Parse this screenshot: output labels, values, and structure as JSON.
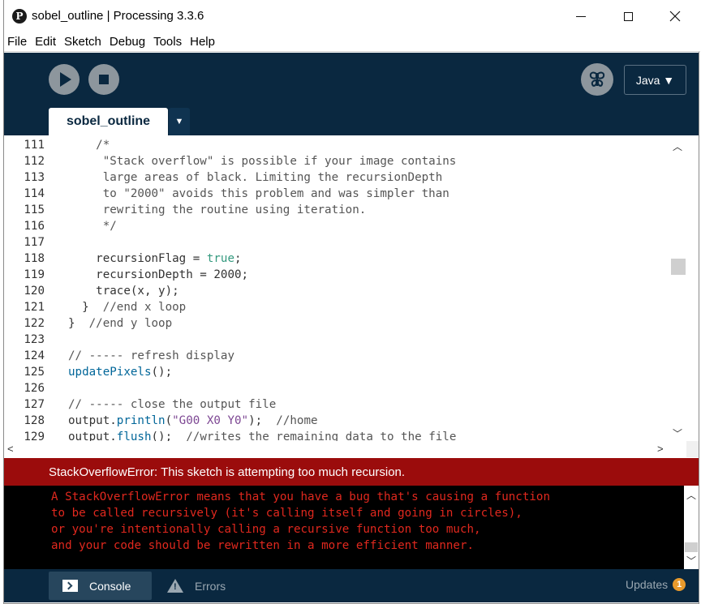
{
  "window": {
    "title": "sobel_outline | Processing 3.3.6",
    "logo": "P"
  },
  "menu": [
    "File",
    "Edit",
    "Sketch",
    "Debug",
    "Tools",
    "Help"
  ],
  "toolbar": {
    "run_icon": "play-icon",
    "stop_icon": "stop-icon",
    "debug_icon": "debug-butterfly-icon",
    "mode": "Java ▼"
  },
  "tabs": {
    "active": "sobel_outline",
    "menu_arrow": "▼"
  },
  "editor": {
    "lines": [
      {
        "n": "111",
        "text": "    /*"
      },
      {
        "n": "112",
        "text": "     \"Stack overflow\" is possible if your image contains"
      },
      {
        "n": "113",
        "text": "     large areas of black. Limiting the recursionDepth"
      },
      {
        "n": "114",
        "text": "     to \"2000\" avoids this problem and was simpler than"
      },
      {
        "n": "115",
        "text": "     rewriting the routine using iteration."
      },
      {
        "n": "116",
        "text": "     */"
      },
      {
        "n": "117",
        "text": ""
      },
      {
        "n": "118",
        "text": "    recursionFlag = true;"
      },
      {
        "n": "119",
        "text": "    recursionDepth = 2000;"
      },
      {
        "n": "120",
        "text": "    trace(x, y);"
      },
      {
        "n": "121",
        "text": "  }  //end x loop"
      },
      {
        "n": "122",
        "text": "}  //end y loop"
      },
      {
        "n": "123",
        "text": ""
      },
      {
        "n": "124",
        "text": "// ----- refresh display"
      },
      {
        "n": "125",
        "text": "updatePixels();"
      },
      {
        "n": "126",
        "text": ""
      },
      {
        "n": "127",
        "text": "// ----- close the output file"
      },
      {
        "n": "128",
        "text": "output.println(\"G00 X0 Y0\");  //home"
      },
      {
        "n": "129",
        "text": "output.flush();  //writes the remaining data to the file"
      }
    ]
  },
  "error": {
    "message": "StackOverflowError: This sketch is attempting too much recursion."
  },
  "console": {
    "lines": [
      "A StackOverflowError means that you have a bug that's causing a function",
      "to be called recursively (it's calling itself and going in circles),",
      "or you're intentionally calling a recursive function too much,",
      "and your code should be rewritten in a more efficient manner."
    ]
  },
  "footer": {
    "console_label": "Console",
    "errors_label": "Errors",
    "updates_label": "Updates",
    "updates_count": "1"
  },
  "colors": {
    "toolbar_bg": "#0a2840",
    "error_bg": "#9b0c0c",
    "console_text": "#e0281e",
    "keyword": "#33997e",
    "function": "#006699",
    "string": "#7d4793"
  }
}
